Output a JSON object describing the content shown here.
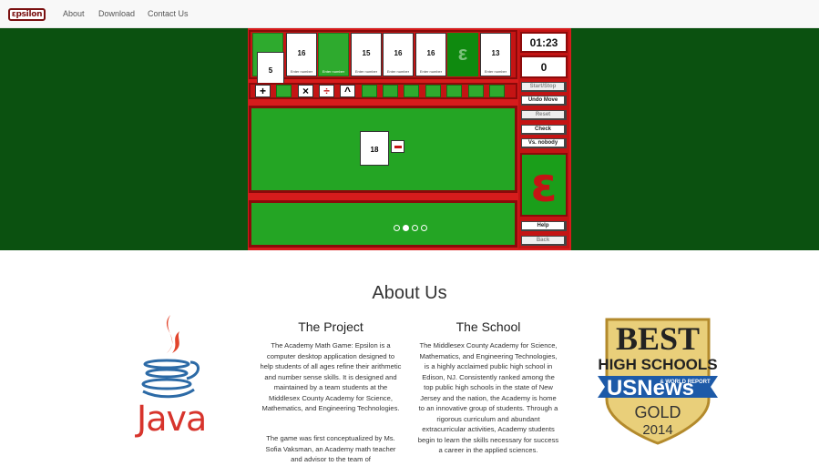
{
  "nav": {
    "brand": "εpsilon",
    "links": [
      "About",
      "Download",
      "Contact Us"
    ]
  },
  "game": {
    "top_cards": [
      {
        "value": "16",
        "hint": "Enter number"
      },
      {
        "value": "",
        "hint": "Enter number"
      },
      {
        "value": "15",
        "hint": "Enter number"
      },
      {
        "value": "16",
        "hint": "Enter number"
      },
      {
        "value": "16",
        "hint": "Enter number"
      },
      {
        "value": "13",
        "hint": "Enter number"
      }
    ],
    "floating_card": "5",
    "operators": [
      "+",
      "×",
      "÷",
      "^"
    ],
    "work_card": "18",
    "timer": "01:23",
    "score": "0",
    "buttons": {
      "start_stop": "Start/Stop",
      "undo": "Undo Move",
      "reset": "Reset",
      "check": "Check",
      "vs": "Vs. nobody",
      "help": "Help",
      "back": "Back"
    },
    "logo_letter": "ε",
    "colors": {
      "felt": "#24a524",
      "frame": "#c41414",
      "background": "#0b5110"
    }
  },
  "about": {
    "title": "About Us",
    "project": {
      "title": "The Project",
      "p1": "The Academy Math Game: Epsilon is a computer desktop application designed to help students of all ages refine their arithmetic and number sense skills. It is designed and maintained by a team students at the Middlesex County Academy for Science, Mathematics, and Engineering Technologies.",
      "p2": "The game was first conceptualized by Ms. Sofia Vaksman, an Academy math teacher and advisor to the team of"
    },
    "school": {
      "title": "The School",
      "p1": "The Middlesex County Academy for Science, Mathematics, and Engineering Technologies, is a highly acclaimed public high school in Edison, NJ. Consistently ranked among the top public high schools in the state of New Jersey and the nation, the Academy is home to an innovative group of students. Through a rigorous curriculum and abundant extracurricular activities, Academy students begin to learn the skills necessary for success a career in the applied sciences."
    },
    "java_label": "Java",
    "badge": {
      "line1": "BEST",
      "line2": "HIGH SCHOOLS",
      "brand": "USNews",
      "sub": "& WORLD REPORT",
      "tier": "GOLD",
      "year": "2014"
    }
  }
}
